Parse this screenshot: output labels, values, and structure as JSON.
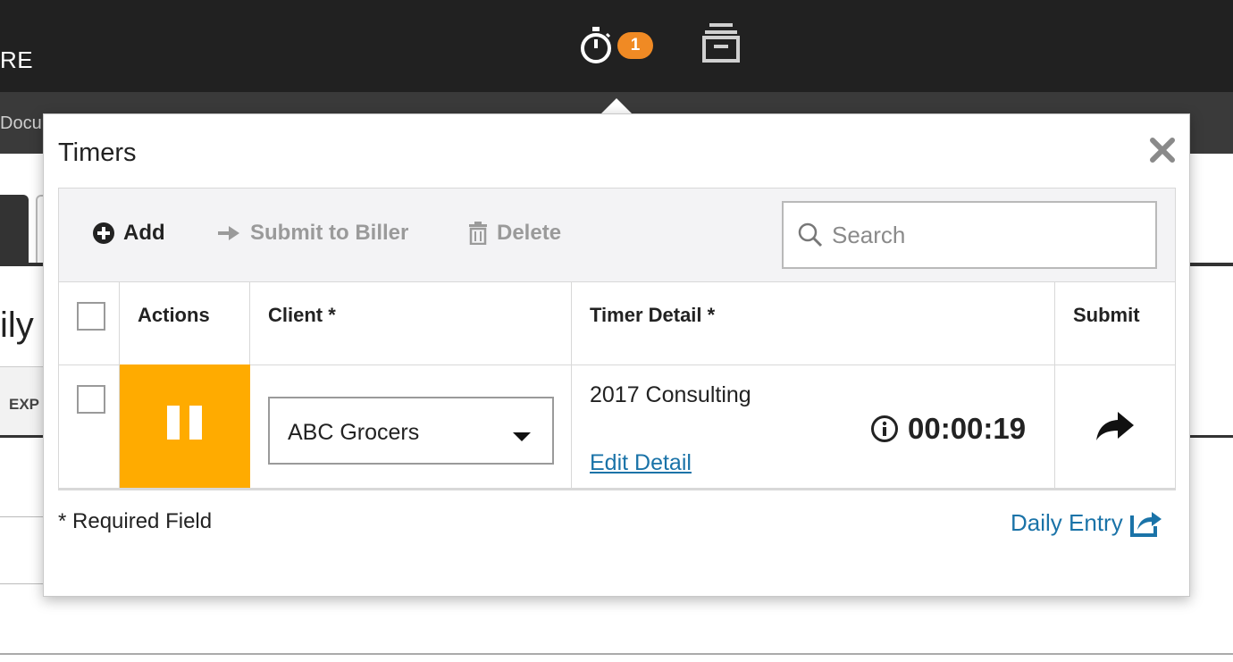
{
  "header": {
    "brand_fragment": "RE",
    "timer_badge_count": "1",
    "subnav_fragment": "Docu"
  },
  "background": {
    "heading_fragment": "ily",
    "tab_fragment": "EXP"
  },
  "timers_popover": {
    "title": "Timers",
    "toolbar": {
      "add_label": "Add",
      "submit_label": "Submit to Biller",
      "delete_label": "Delete",
      "search_placeholder": "Search"
    },
    "columns": {
      "actions": "Actions",
      "client": "Client *",
      "timer_detail": "Timer Detail *",
      "submit": "Submit"
    },
    "rows": [
      {
        "client": "ABC Grocers",
        "detail": "2017 Consulting",
        "edit_link": "Edit Detail",
        "elapsed": "00:00:19",
        "state": "running"
      }
    ],
    "footer": {
      "required_note": "* Required Field",
      "daily_entry_link": "Daily Entry"
    }
  },
  "colors": {
    "topbar": "#212121",
    "accent_badge": "#f08a24",
    "pause_button": "#ffab00",
    "link": "#1a73a8"
  },
  "icons": [
    "stopwatch-icon",
    "archive-icon",
    "close-icon",
    "plus-circle-icon",
    "arrow-right-icon",
    "trash-icon",
    "search-icon",
    "pause-icon",
    "chevron-down-icon",
    "info-icon",
    "share-arrow-icon",
    "external-link-icon"
  ]
}
